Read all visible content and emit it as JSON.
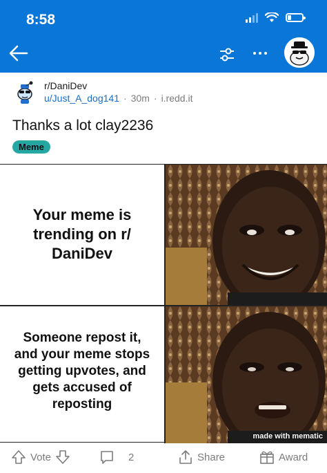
{
  "status_bar": {
    "time": "8:58"
  },
  "nav": {
    "back_icon": "arrow-left-icon",
    "sort_icon": "sort-sliders-icon",
    "more_icon": "more-dots-icon",
    "avatar": "user-avatar"
  },
  "post": {
    "subreddit": "r/DaniDev",
    "author": "u/Just_A_dog141",
    "time_ago": "30m",
    "domain": "i.redd.it",
    "title": "Thanks a lot clay2236",
    "flair": "Meme"
  },
  "meme": {
    "panel_top_text": "Your meme is trending on r/ DaniDev",
    "panel_bottom_text": "Someone repost it, and your meme stops getting upvotes, and gets accused of reposting",
    "watermark": "made with mematic"
  },
  "actions": {
    "vote_label": "Vote",
    "comments_count": "2",
    "share_label": "Share",
    "award_label": "Award"
  },
  "colors": {
    "header_blue": "#0a76d8",
    "flair_teal": "#25a7a3",
    "username_blue": "#1a6dc2"
  }
}
